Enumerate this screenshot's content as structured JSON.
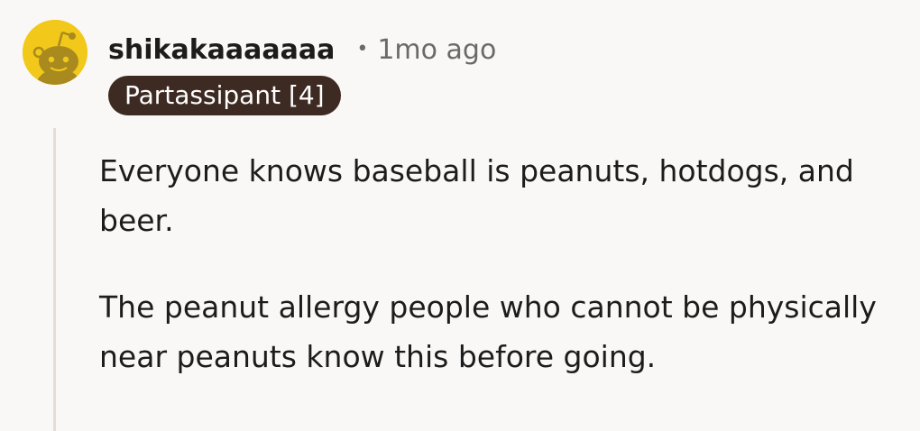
{
  "comment": {
    "author": "shikakaaaaaaa",
    "separator": "•",
    "timestamp": "1mo ago",
    "flair": "Partassipant [4]",
    "avatar_icon": "snoo-avatar-icon",
    "avatar_color": "#f2c81b",
    "flair_color": "#3d2a22",
    "paragraphs": [
      "Everyone knows baseball is peanuts, hotdogs, and beer.",
      "The peanut allergy people who cannot be physically near peanuts know this before going."
    ]
  }
}
